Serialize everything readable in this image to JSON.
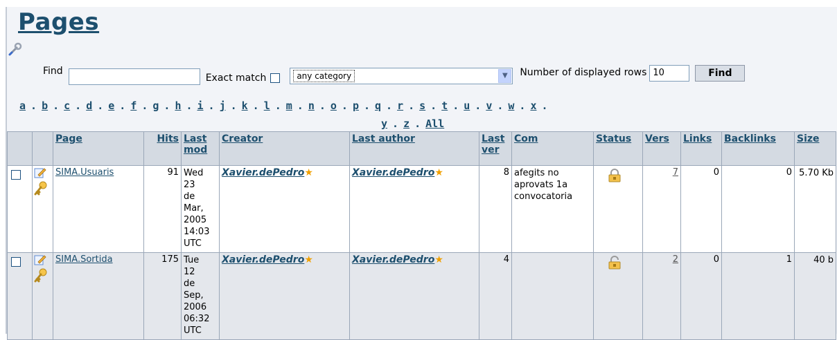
{
  "page": {
    "title": "Pages"
  },
  "search": {
    "find_label": "Find",
    "find_value": "",
    "exact_label": "Exact match",
    "category_value": "any category",
    "rows_label": "Number of displayed rows",
    "rows_value": "10",
    "find_button": "Find"
  },
  "alphabet": {
    "row1": [
      "a",
      "b",
      "c",
      "d",
      "e",
      "f",
      "g",
      "h",
      "i",
      "j",
      "k",
      "l",
      "m",
      "n",
      "o",
      "p",
      "q",
      "r",
      "s",
      "t",
      "u",
      "v",
      "w",
      "x"
    ],
    "row2": [
      "y",
      "z",
      "All"
    ],
    "separator": "."
  },
  "table": {
    "headers": [
      "Page",
      "Hits",
      "Last mod",
      "Creator",
      "Last author",
      "Last ver",
      "Com",
      "Status",
      "Vers",
      "Links",
      "Backlinks",
      "Size"
    ],
    "rows": [
      {
        "page": "SIMA.Usuaris",
        "hits": "91",
        "last_mod": "Wed 23 de Mar, 2005 14:03 UTC",
        "creator": "Xavier.dePedro",
        "last_author": "Xavier.dePedro",
        "last_ver": "8",
        "com": "afegits no aprovats 1a convocatoria",
        "status": "locked-icon",
        "vers": "7",
        "links": "0",
        "backlinks": "0",
        "size": "5.70 Kb"
      },
      {
        "page": "SIMA.Sortida",
        "hits": "175",
        "last_mod": "Tue 12 de Sep, 2006 06:32 UTC",
        "creator": "Xavier.dePedro",
        "last_author": "Xavier.dePedro",
        "last_ver": "4",
        "com": "",
        "status": "unlocked-icon",
        "vers": "2",
        "links": "0",
        "backlinks": "1",
        "size": "40 b"
      }
    ]
  },
  "colors": {
    "link": "#1d4f6e",
    "header_bg": "#d4dae2",
    "star": "#f0a000"
  }
}
